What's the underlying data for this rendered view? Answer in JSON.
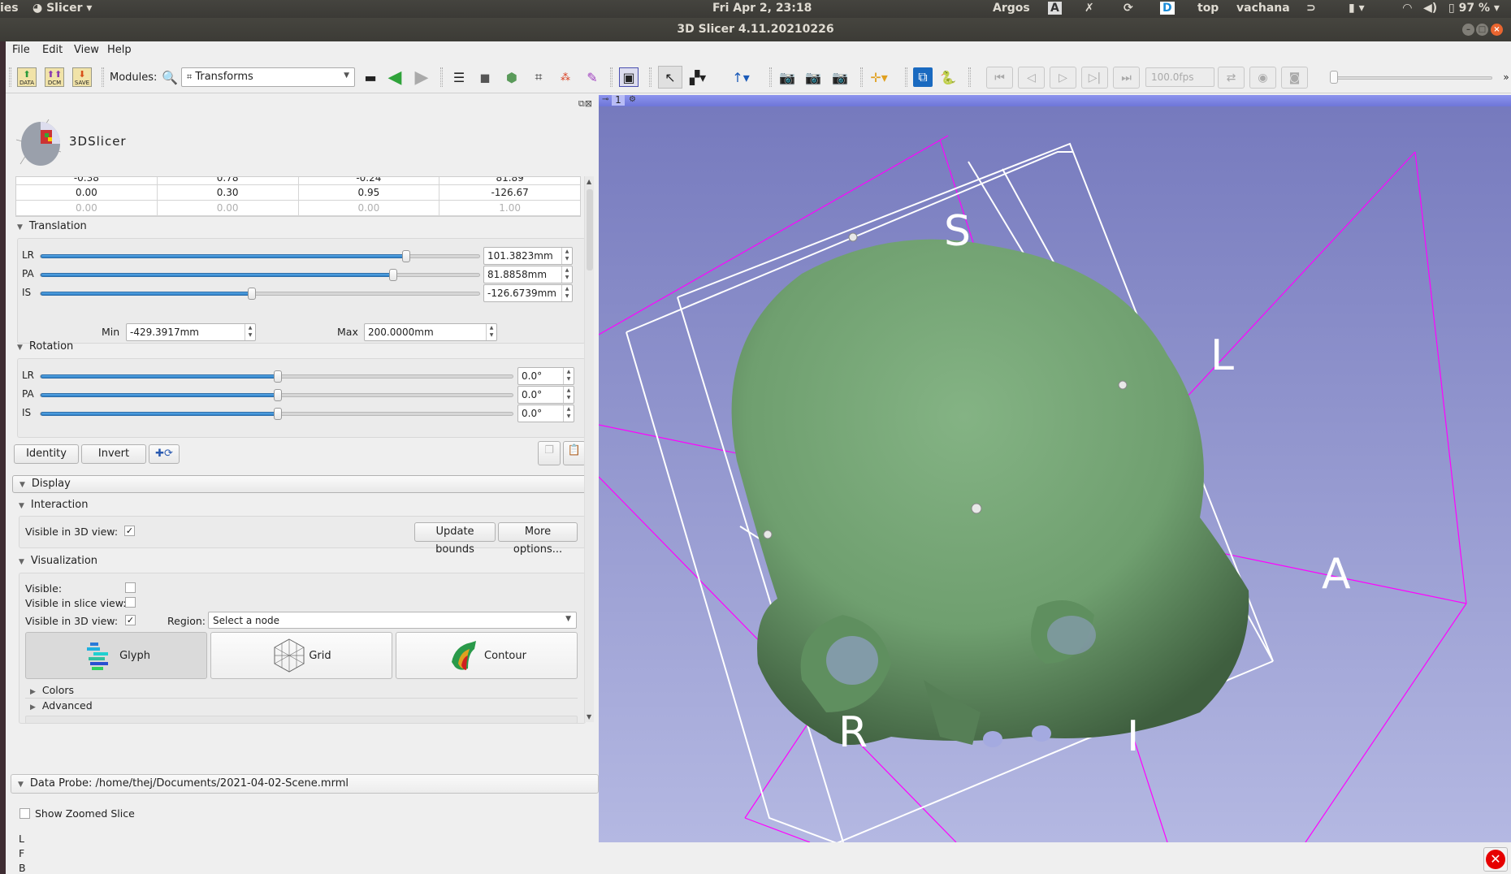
{
  "system_bar": {
    "activities_partial": "ies",
    "app_menu": "Slicer",
    "clock": "Fri Apr  2, 23:18",
    "indicators": [
      "Argos",
      "top",
      "vachana"
    ],
    "battery": "97 %"
  },
  "window": {
    "title": "3D Slicer 4.11.20210226"
  },
  "menu": [
    "File",
    "Edit",
    "View",
    "Help"
  ],
  "toolbar": {
    "data_label": "DATA",
    "dcm_label": "DCM",
    "save_label": "SAVE",
    "modules_label": "Modules:",
    "module_selected": "Transforms",
    "fps": "100.0fps"
  },
  "panel": {
    "logo_text": "3DSlicer",
    "matrix": {
      "partial_row": [
        "-0.38",
        "0.78",
        "-0.24",
        "81.89"
      ],
      "rows": [
        [
          "0.00",
          "0.30",
          "0.95",
          "-126.67"
        ],
        [
          "0.00",
          "0.00",
          "0.00",
          "1.00"
        ]
      ]
    },
    "translation": {
      "title": "Translation",
      "sliders": [
        {
          "label": "LR",
          "value": "101.3823mm",
          "fraction": 0.83
        },
        {
          "label": "PA",
          "value": "81.8858mm",
          "fraction": 0.8
        },
        {
          "label": "IS",
          "value": "-126.6739mm",
          "fraction": 0.48
        }
      ],
      "min_label": "Min",
      "min_value": "-429.3917mm",
      "max_label": "Max",
      "max_value": "200.0000mm"
    },
    "rotation": {
      "title": "Rotation",
      "sliders": [
        {
          "label": "LR",
          "value": "0.0°",
          "fraction": 0.5
        },
        {
          "label": "PA",
          "value": "0.0°",
          "fraction": 0.5
        },
        {
          "label": "IS",
          "value": "0.0°",
          "fraction": 0.5
        }
      ]
    },
    "buttons": {
      "identity": "Identity",
      "invert": "Invert"
    },
    "display": {
      "title": "Display",
      "interaction": {
        "title": "Interaction",
        "visible_3d_label": "Visible in 3D view:",
        "visible_3d_checked": true,
        "update_bounds": "Update bounds",
        "more_options": "More options..."
      },
      "visualization": {
        "title": "Visualization",
        "visible_label": "Visible:",
        "visible_checked": false,
        "visible_slice_label": "Visible in slice view:",
        "visible_slice_checked": false,
        "visible_3d_label": "Visible in 3D view:",
        "visible_3d_checked": true,
        "region_label": "Region:",
        "region_value": "Select a node",
        "modes": [
          "Glyph",
          "Grid",
          "Contour"
        ],
        "colors": "Colors",
        "advanced": "Advanced"
      }
    },
    "data_probe": {
      "title": "Data Probe: /home/thej/Documents/2021-04-02-Scene.mrml",
      "show_zoomed": "Show Zoomed Slice",
      "lines": [
        "L",
        "F",
        "B"
      ]
    }
  },
  "view3d": {
    "view_number": "1",
    "labels": {
      "S": "S",
      "L": "L",
      "A": "A",
      "R": "R",
      "I": "I"
    },
    "background_top": "#7579bd",
    "background_bottom": "#b4b8e2",
    "model_color": "#7aa97a",
    "roi_color": "#ff00ff"
  }
}
